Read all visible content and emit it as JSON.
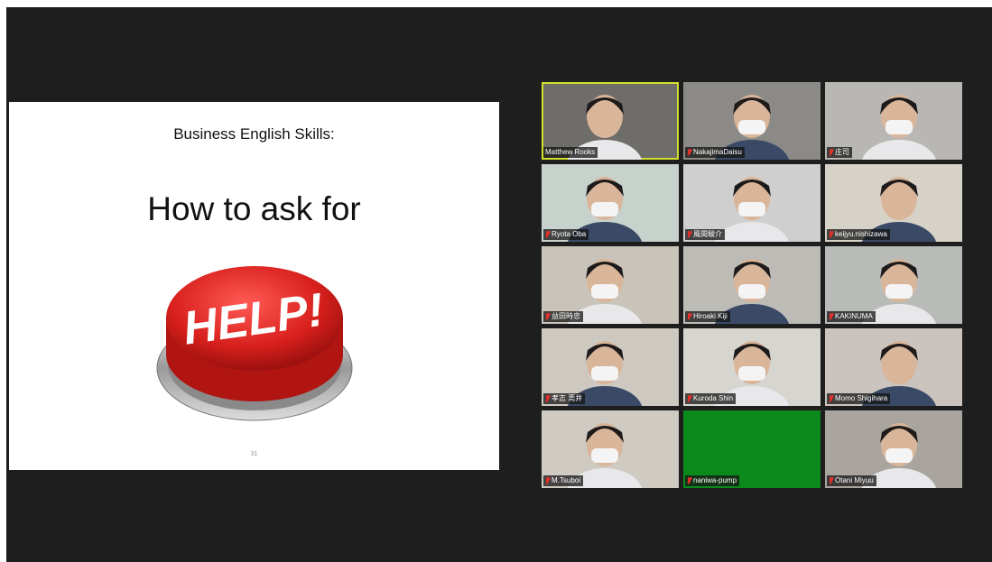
{
  "slide": {
    "subtitle": "Business English Skills:",
    "title": "How to ask for",
    "button_text": "HELP!",
    "page_number": "31"
  },
  "participants": [
    {
      "name": "Matthew Rooks",
      "active": true,
      "muted": false,
      "bg": "#6f6d6a"
    },
    {
      "name": "NakajimaDaisu",
      "active": false,
      "muted": true,
      "bg": "#8b8a86"
    },
    {
      "name": "庄司",
      "active": false,
      "muted": true,
      "bg": "#b9b7b3"
    },
    {
      "name": "Ryota Oba",
      "active": false,
      "muted": true,
      "bg": "#c8d2cc"
    },
    {
      "name": "風間駿介",
      "active": false,
      "muted": true,
      "bg": "#cfcfcf"
    },
    {
      "name": "keijyu.nishizawa",
      "active": false,
      "muted": true,
      "bg": "#d6d2c8"
    },
    {
      "name": "益田時忠",
      "active": false,
      "muted": true,
      "bg": "#c9c4ba"
    },
    {
      "name": "Hiroaki Kiji",
      "active": false,
      "muted": true,
      "bg": "#bdbbb6"
    },
    {
      "name": "KAKINUMA",
      "active": false,
      "muted": true,
      "bg": "#b9bbb9"
    },
    {
      "name": "孝志 莞井",
      "active": false,
      "muted": true,
      "bg": "#cdc8c0"
    },
    {
      "name": "Kuroda Shin",
      "active": false,
      "muted": true,
      "bg": "#d7d5d0"
    },
    {
      "name": "Momo Shigihara",
      "active": false,
      "muted": true,
      "bg": "#cbc3bd"
    },
    {
      "name": "M.Tsuboi",
      "active": false,
      "muted": true,
      "bg": "#cfcac2"
    },
    {
      "name": "naniwa-pump",
      "active": false,
      "muted": true,
      "bg": "#0b8a1c"
    },
    {
      "name": "Otani Miyuu",
      "active": false,
      "muted": true,
      "bg": "#a9a59e"
    }
  ],
  "colors": {
    "active_speaker_border": "#d3e02b",
    "mute": "#e0302b",
    "background": "#1e1e1e"
  }
}
